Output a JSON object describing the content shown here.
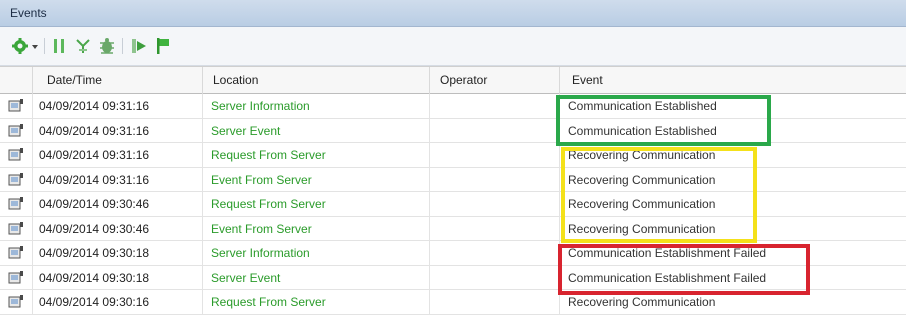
{
  "panel": {
    "title": "Events"
  },
  "toolbar": {
    "buttons": [
      {
        "icon": "green-gear-dropdown-icon"
      },
      {
        "icon": "pause-icon"
      },
      {
        "icon": "antenna-icon"
      },
      {
        "icon": "bug-icon"
      },
      {
        "icon": "forward-step-icon"
      },
      {
        "icon": "flag-icon"
      }
    ]
  },
  "columns": {
    "datetime": "Date/Time",
    "location": "Location",
    "operator": "Operator",
    "event": "Event"
  },
  "rows": [
    {
      "datetime": "04/09/2014 09:31:16",
      "location": "Server Information",
      "operator": "",
      "event": "Communication Established"
    },
    {
      "datetime": "04/09/2014 09:31:16",
      "location": "Server Event",
      "operator": "",
      "event": "Communication Established"
    },
    {
      "datetime": "04/09/2014 09:31:16",
      "location": "Request From Server",
      "operator": "",
      "event": "Recovering Communication"
    },
    {
      "datetime": "04/09/2014 09:31:16",
      "location": "Event From Server",
      "operator": "",
      "event": "Recovering Communication"
    },
    {
      "datetime": "04/09/2014 09:30:46",
      "location": "Request From Server",
      "operator": "",
      "event": "Recovering Communication"
    },
    {
      "datetime": "04/09/2014 09:30:46",
      "location": "Event From Server",
      "operator": "",
      "event": "Recovering Communication"
    },
    {
      "datetime": "04/09/2014 09:30:18",
      "location": "Server Information",
      "operator": "",
      "event": "Communication Establishment Failed"
    },
    {
      "datetime": "04/09/2014 09:30:18",
      "location": "Server Event",
      "operator": "",
      "event": "Communication Establishment Failed"
    },
    {
      "datetime": "04/09/2014 09:30:16",
      "location": "Request From Server",
      "operator": "",
      "event": "Recovering Communication"
    }
  ],
  "highlights": {
    "green": "#2aa84a",
    "yellow": "#f4e11a",
    "red": "#d8242f"
  },
  "colors": {
    "location_text": "#2a9b2a",
    "title_bar": "#c4d5ea"
  }
}
